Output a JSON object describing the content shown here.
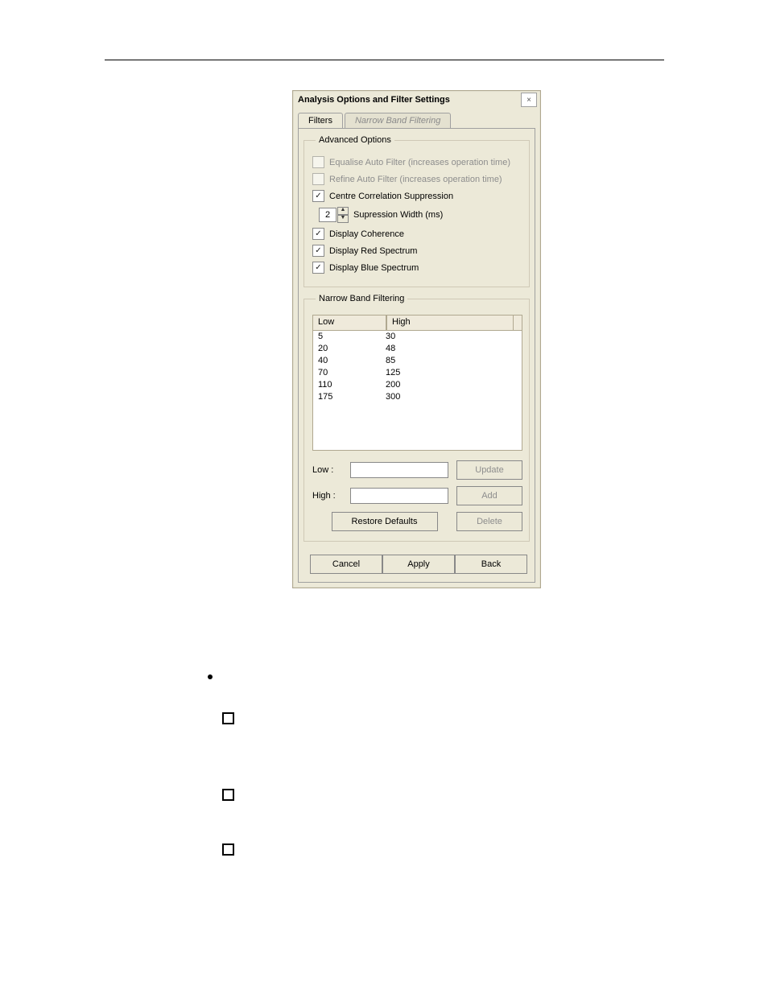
{
  "dialog": {
    "title": "Analysis Options and Filter Settings",
    "tabs": {
      "active": "Filters",
      "inactive": "Narrow Band Filtering"
    },
    "advanced": {
      "legend": "Advanced Options",
      "equalise": "Equalise Auto Filter (increases operation time)",
      "refine": "Refine Auto Filter (increases operation time)",
      "centre": "Centre Correlation Suppression",
      "supWidthVal": "2",
      "supWidthLbl": "Supression Width (ms)",
      "coherence": "Display Coherence",
      "redSpectrum": "Display Red Spectrum",
      "blueSpectrum": "Display Blue Spectrum"
    },
    "narrow": {
      "legend": "Narrow Band Filtering",
      "colLow": "Low",
      "colHigh": "High",
      "rows": [
        {
          "low": "5",
          "high": "30"
        },
        {
          "low": "20",
          "high": "48"
        },
        {
          "low": "40",
          "high": "85"
        },
        {
          "low": "70",
          "high": "125"
        },
        {
          "low": "110",
          "high": "200"
        },
        {
          "low": "175",
          "high": "300"
        }
      ],
      "lowLbl": "Low :",
      "highLbl": "High :",
      "lowVal": "",
      "highVal": "",
      "update": "Update",
      "add": "Add",
      "delete": "Delete",
      "restore": "Restore Defaults"
    },
    "footer": {
      "cancel": "Cancel",
      "apply": "Apply",
      "back": "Back"
    }
  }
}
